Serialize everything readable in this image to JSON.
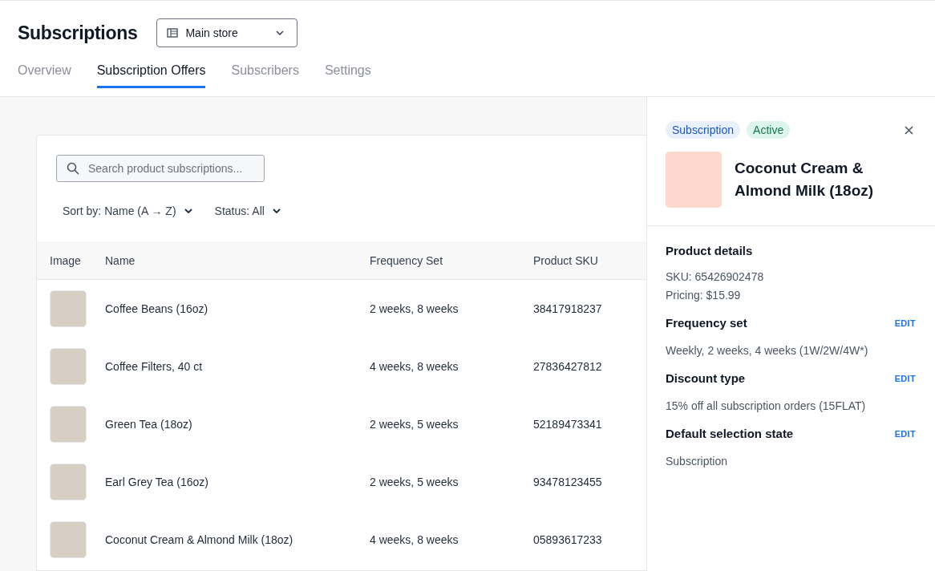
{
  "header": {
    "title": "Subscriptions",
    "store_select": {
      "value": "Main store"
    }
  },
  "tabs": [
    {
      "label": "Overview",
      "selected": false
    },
    {
      "label": "Subscription Offers",
      "selected": true
    },
    {
      "label": "Subscribers",
      "selected": false
    },
    {
      "label": "Settings",
      "selected": false
    }
  ],
  "search": {
    "placeholder": "Search product subscriptions..."
  },
  "filters": [
    {
      "label": "Sort by: Name (A → Z)"
    },
    {
      "label": "Status: All"
    }
  ],
  "table": {
    "columns": [
      "Image",
      "Name",
      "Frequency Set",
      "Product SKU"
    ],
    "rows": [
      {
        "name": "Coffee Beans (16oz)",
        "frequency": "2 weeks, 8 weeks",
        "sku": "38417918237"
      },
      {
        "name": "Coffee Filters, 40 ct",
        "frequency": "4 weeks, 8 weeks",
        "sku": "27836427812"
      },
      {
        "name": "Green Tea (18oz)",
        "frequency": "2 weeks, 5 weeks",
        "sku": "52189473341"
      },
      {
        "name": "Earl Grey Tea (16oz)",
        "frequency": "2 weeks, 5 weeks",
        "sku": "93478123455"
      },
      {
        "name": "Coconut Cream & Almond Milk (18oz)",
        "frequency": "4 weeks, 8 weeks",
        "sku": "05893617233"
      }
    ]
  },
  "panel": {
    "badges": [
      {
        "label": "Subscription",
        "kind": "type"
      },
      {
        "label": "Active",
        "kind": "status"
      }
    ],
    "title": "Coconut Cream & Almond Milk (18oz)",
    "sections": [
      {
        "title": "Product details",
        "lines": [
          "SKU: 65426902478",
          "Pricing: $15.99"
        ]
      },
      {
        "title": "Frequency set",
        "action": "EDIT",
        "lines": [
          "Weekly, 2 weeks, 4 weeks (1W/2W/4W*)"
        ]
      },
      {
        "title": "Discount type",
        "action": "EDIT",
        "lines": [
          "15% off all subscription orders (15FLAT)"
        ]
      },
      {
        "title": "Default selection state",
        "action": "EDIT",
        "lines": [
          "Subscription"
        ]
      }
    ]
  }
}
